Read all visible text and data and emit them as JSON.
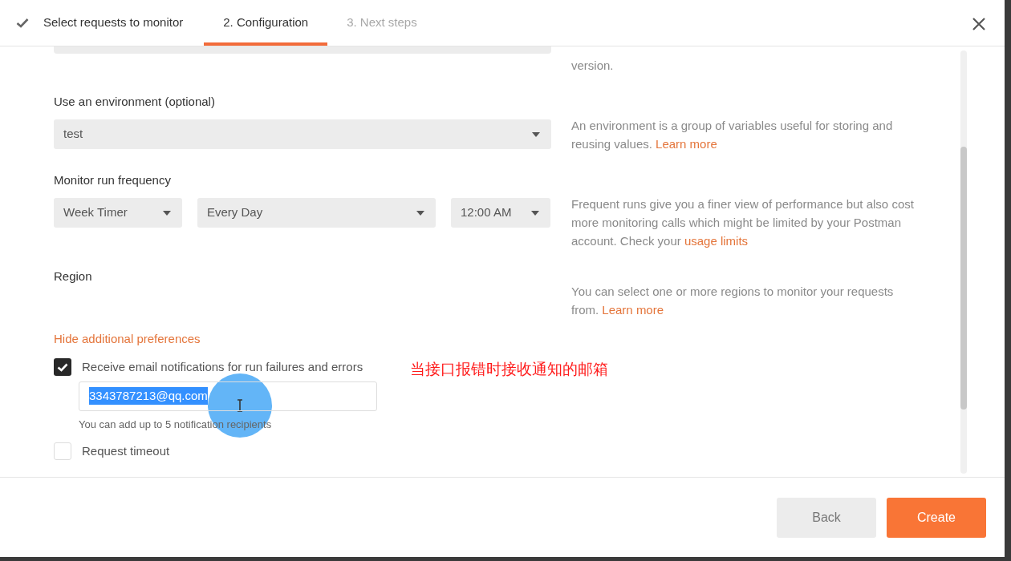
{
  "steps": [
    {
      "label": "Select requests to monitor",
      "completed": true,
      "selected": false
    },
    {
      "label": "2. Configuration",
      "completed": false,
      "selected": true
    },
    {
      "label": "3. Next steps",
      "completed": false,
      "selected": false
    }
  ],
  "partial_note": "version.",
  "fields": [
    {
      "kind": "select",
      "label": "Use an environment (optional)",
      "selects": [
        "test"
      ],
      "help": "An environment is a group of variables useful for storing and reusing values. ",
      "link": "Learn more"
    },
    {
      "kind": "select",
      "label": "Monitor run frequency",
      "selects": [
        "Week Timer",
        "Every Day",
        "12:00 AM"
      ],
      "help": "Frequent runs give you a finer view of performance but also cost more monitoring calls which might be limited by your Postman account. Check your ",
      "link": "usage limits"
    },
    {
      "kind": "region",
      "label": "Region",
      "help": "You can select one or more regions to monitor your requests from. ",
      "link": "Learn more"
    }
  ],
  "toggle_link": "Hide additional preferences",
  "preferences": [
    {
      "label": "Receive email notifications for run failures and errors",
      "checked": true,
      "email": {
        "value": "3343787213@qq.com",
        "selected": true
      },
      "hint": "You can add up to 5 notification recipients"
    },
    {
      "label": "Request timeout",
      "checked": false
    }
  ],
  "annotation": "当接口报错时接收通知的邮箱",
  "buttons": [
    {
      "label": "Back",
      "kind": "secondary"
    },
    {
      "label": "Create",
      "kind": "primary"
    }
  ]
}
